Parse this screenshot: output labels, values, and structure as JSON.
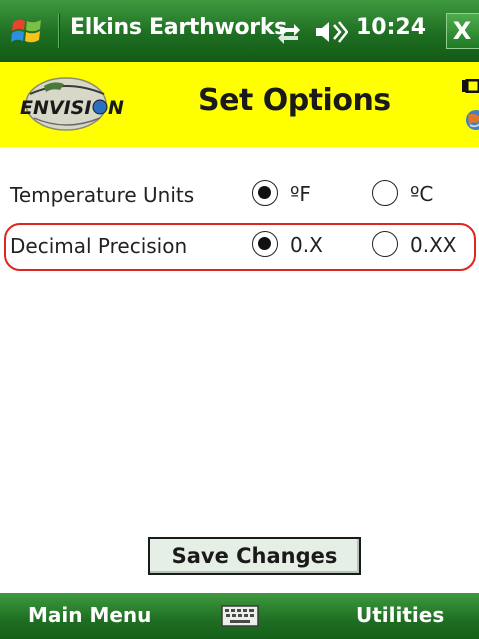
{
  "titlebar": {
    "app_title": "Elkins Earthworks",
    "time": "10:24",
    "close_label": "X",
    "start_icon": "windows-flag-icon",
    "connectivity_icon": "connectivity-icon",
    "volume_icon": "speaker-icon"
  },
  "header": {
    "logo_text": "ENVISION",
    "title": "Set Options",
    "background": "#ffff00",
    "battery_icon": "battery-icon",
    "globe_icon": "globe-icon"
  },
  "options": [
    {
      "label": "Temperature Units",
      "choices": [
        {
          "label": "ºF",
          "selected": true
        },
        {
          "label": "ºC",
          "selected": false
        }
      ]
    },
    {
      "label": "Decimal Precision",
      "highlighted": true,
      "choices": [
        {
          "label": "0.X",
          "selected": true
        },
        {
          "label": "0.XX",
          "selected": false
        }
      ]
    }
  ],
  "save_button": {
    "label": "Save Changes"
  },
  "softkeys": {
    "left": "Main Menu",
    "right": "Utilities",
    "center_icon": "keyboard-icon"
  },
  "colors": {
    "bar_green": "#1e6e22",
    "highlight_red": "#e0241f"
  }
}
